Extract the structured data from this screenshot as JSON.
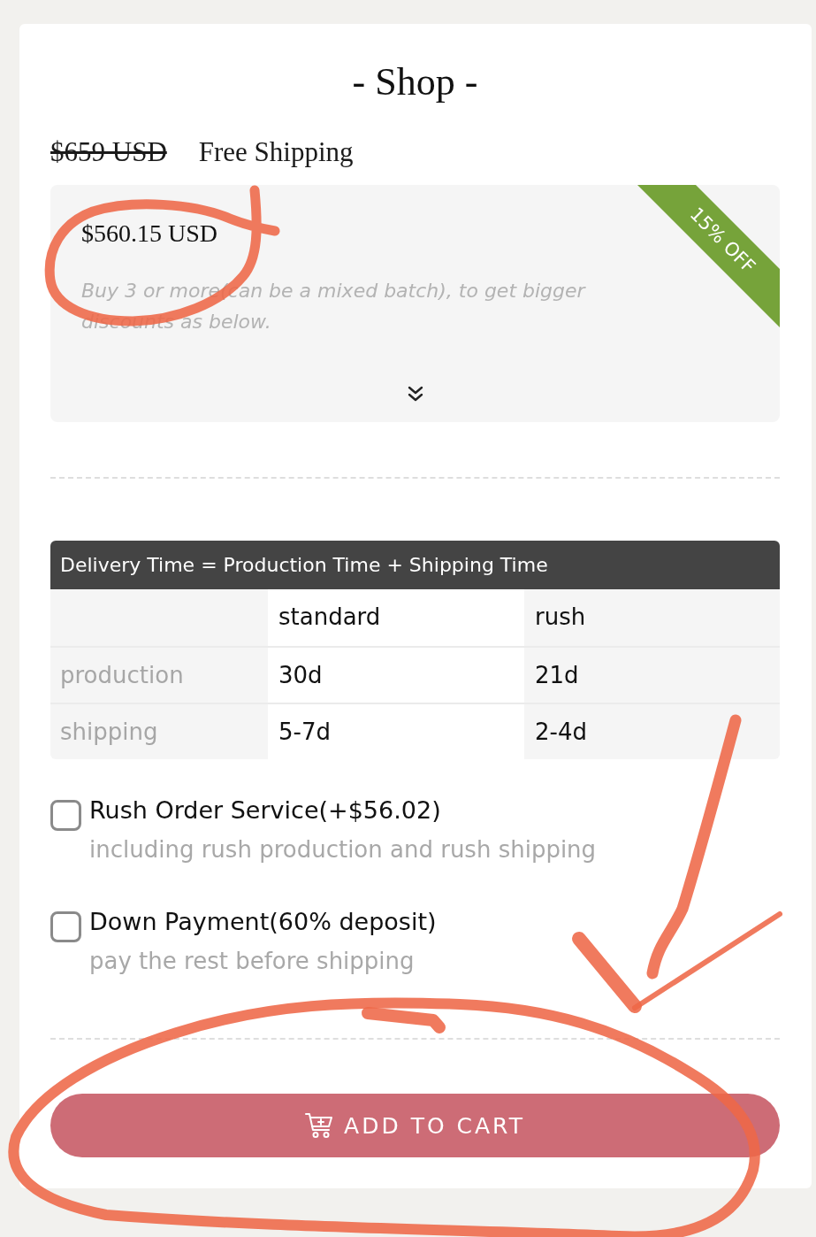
{
  "title": "- Shop -",
  "pricing": {
    "original_price": "$659 USD",
    "shipping_note": "Free Shipping"
  },
  "discount_box": {
    "price": "$560.15 USD",
    "ribbon": "15% OFF",
    "note": "Buy 3 or more(can be a mixed batch), to get bigger discounts as below.",
    "expanded": false
  },
  "delivery_table": {
    "title": "Delivery Time = Production Time + Shipping Time",
    "columns": [
      "standard",
      "rush"
    ],
    "rows": [
      {
        "label": "production",
        "cells": [
          "30d",
          "21d"
        ]
      },
      {
        "label": "shipping",
        "cells": [
          "5-7d",
          "2-4d"
        ]
      }
    ]
  },
  "options": [
    {
      "label": "Rush Order Service(+$56.02)",
      "description": "including rush production and rush shipping",
      "checked": false
    },
    {
      "label": "Down Payment(60% deposit)",
      "description": "pay the rest before shipping",
      "checked": false
    }
  ],
  "add_to_cart_button": {
    "label": "ADD TO CART"
  }
}
